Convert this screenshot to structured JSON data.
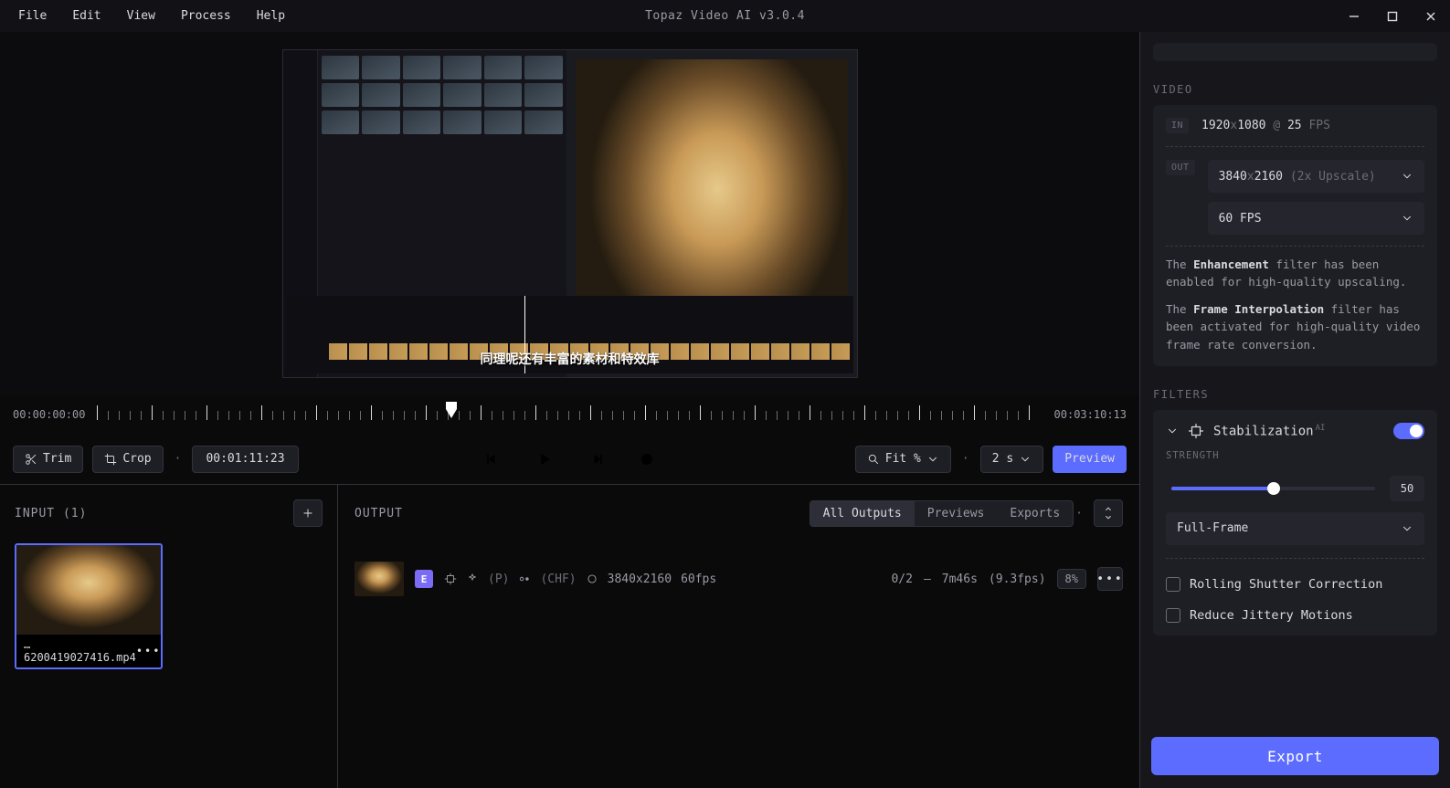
{
  "app": {
    "title": "Topaz Video AI  v3.0.4"
  },
  "menu": {
    "file": "File",
    "edit": "Edit",
    "view": "View",
    "process": "Process",
    "help": "Help"
  },
  "preview": {
    "caption": "同理呢还有丰富的素材和特效库"
  },
  "timeline": {
    "start": "00:00:00:00",
    "end": "00:03:10:13",
    "current": "00:01:11:23",
    "playhead_pct": 37
  },
  "toolbar": {
    "trim": "Trim",
    "crop": "Crop",
    "fit": "Fit %",
    "duration": "2 s",
    "preview": "Preview"
  },
  "input": {
    "title": "INPUT (1)",
    "filename": "…6200419027416.mp4"
  },
  "output": {
    "title": "OUTPUT",
    "tabs": {
      "all": "All Outputs",
      "previews": "Previews",
      "exports": "Exports"
    },
    "row": {
      "chip": "E",
      "model_tag": "(P)",
      "codec": "(CHF)",
      "res": "3840x2160",
      "fps": "60fps",
      "progress": "0/2",
      "dash": "—",
      "eta": "7m46s",
      "rate": "(9.3fps)",
      "pct": "8%"
    }
  },
  "side": {
    "video_section": "VIDEO",
    "in_label": "IN",
    "in_res_w": "1920",
    "in_res_x": "x",
    "in_res_h": "1080",
    "in_at": "@",
    "in_fps": "25",
    "in_fps_u": "FPS",
    "out_label": "OUT",
    "out_res": "3840",
    "out_x": "x",
    "out_res2": "2160",
    "out_note": "(2x Upscale)",
    "out_fps_sel": "60 FPS",
    "info1_pre": "The ",
    "info1_b": "Enhancement",
    "info1_post": " filter has been enabled for high-quality upscaling.",
    "info2_pre": "The ",
    "info2_b": "Frame Interpolation",
    "info2_post": " filter has been activated for high-quality video frame rate conversion.",
    "filters_section": "FILTERS",
    "stab_name": "Stabilization",
    "stab_ai": "AI",
    "strength_label": "STRENGTH",
    "strength_val": "50",
    "strength_pct": 50,
    "stab_mode": "Full-Frame",
    "rs_label": "Rolling Shutter Correction",
    "jitter_label": "Reduce Jittery Motions",
    "export": "Export"
  }
}
